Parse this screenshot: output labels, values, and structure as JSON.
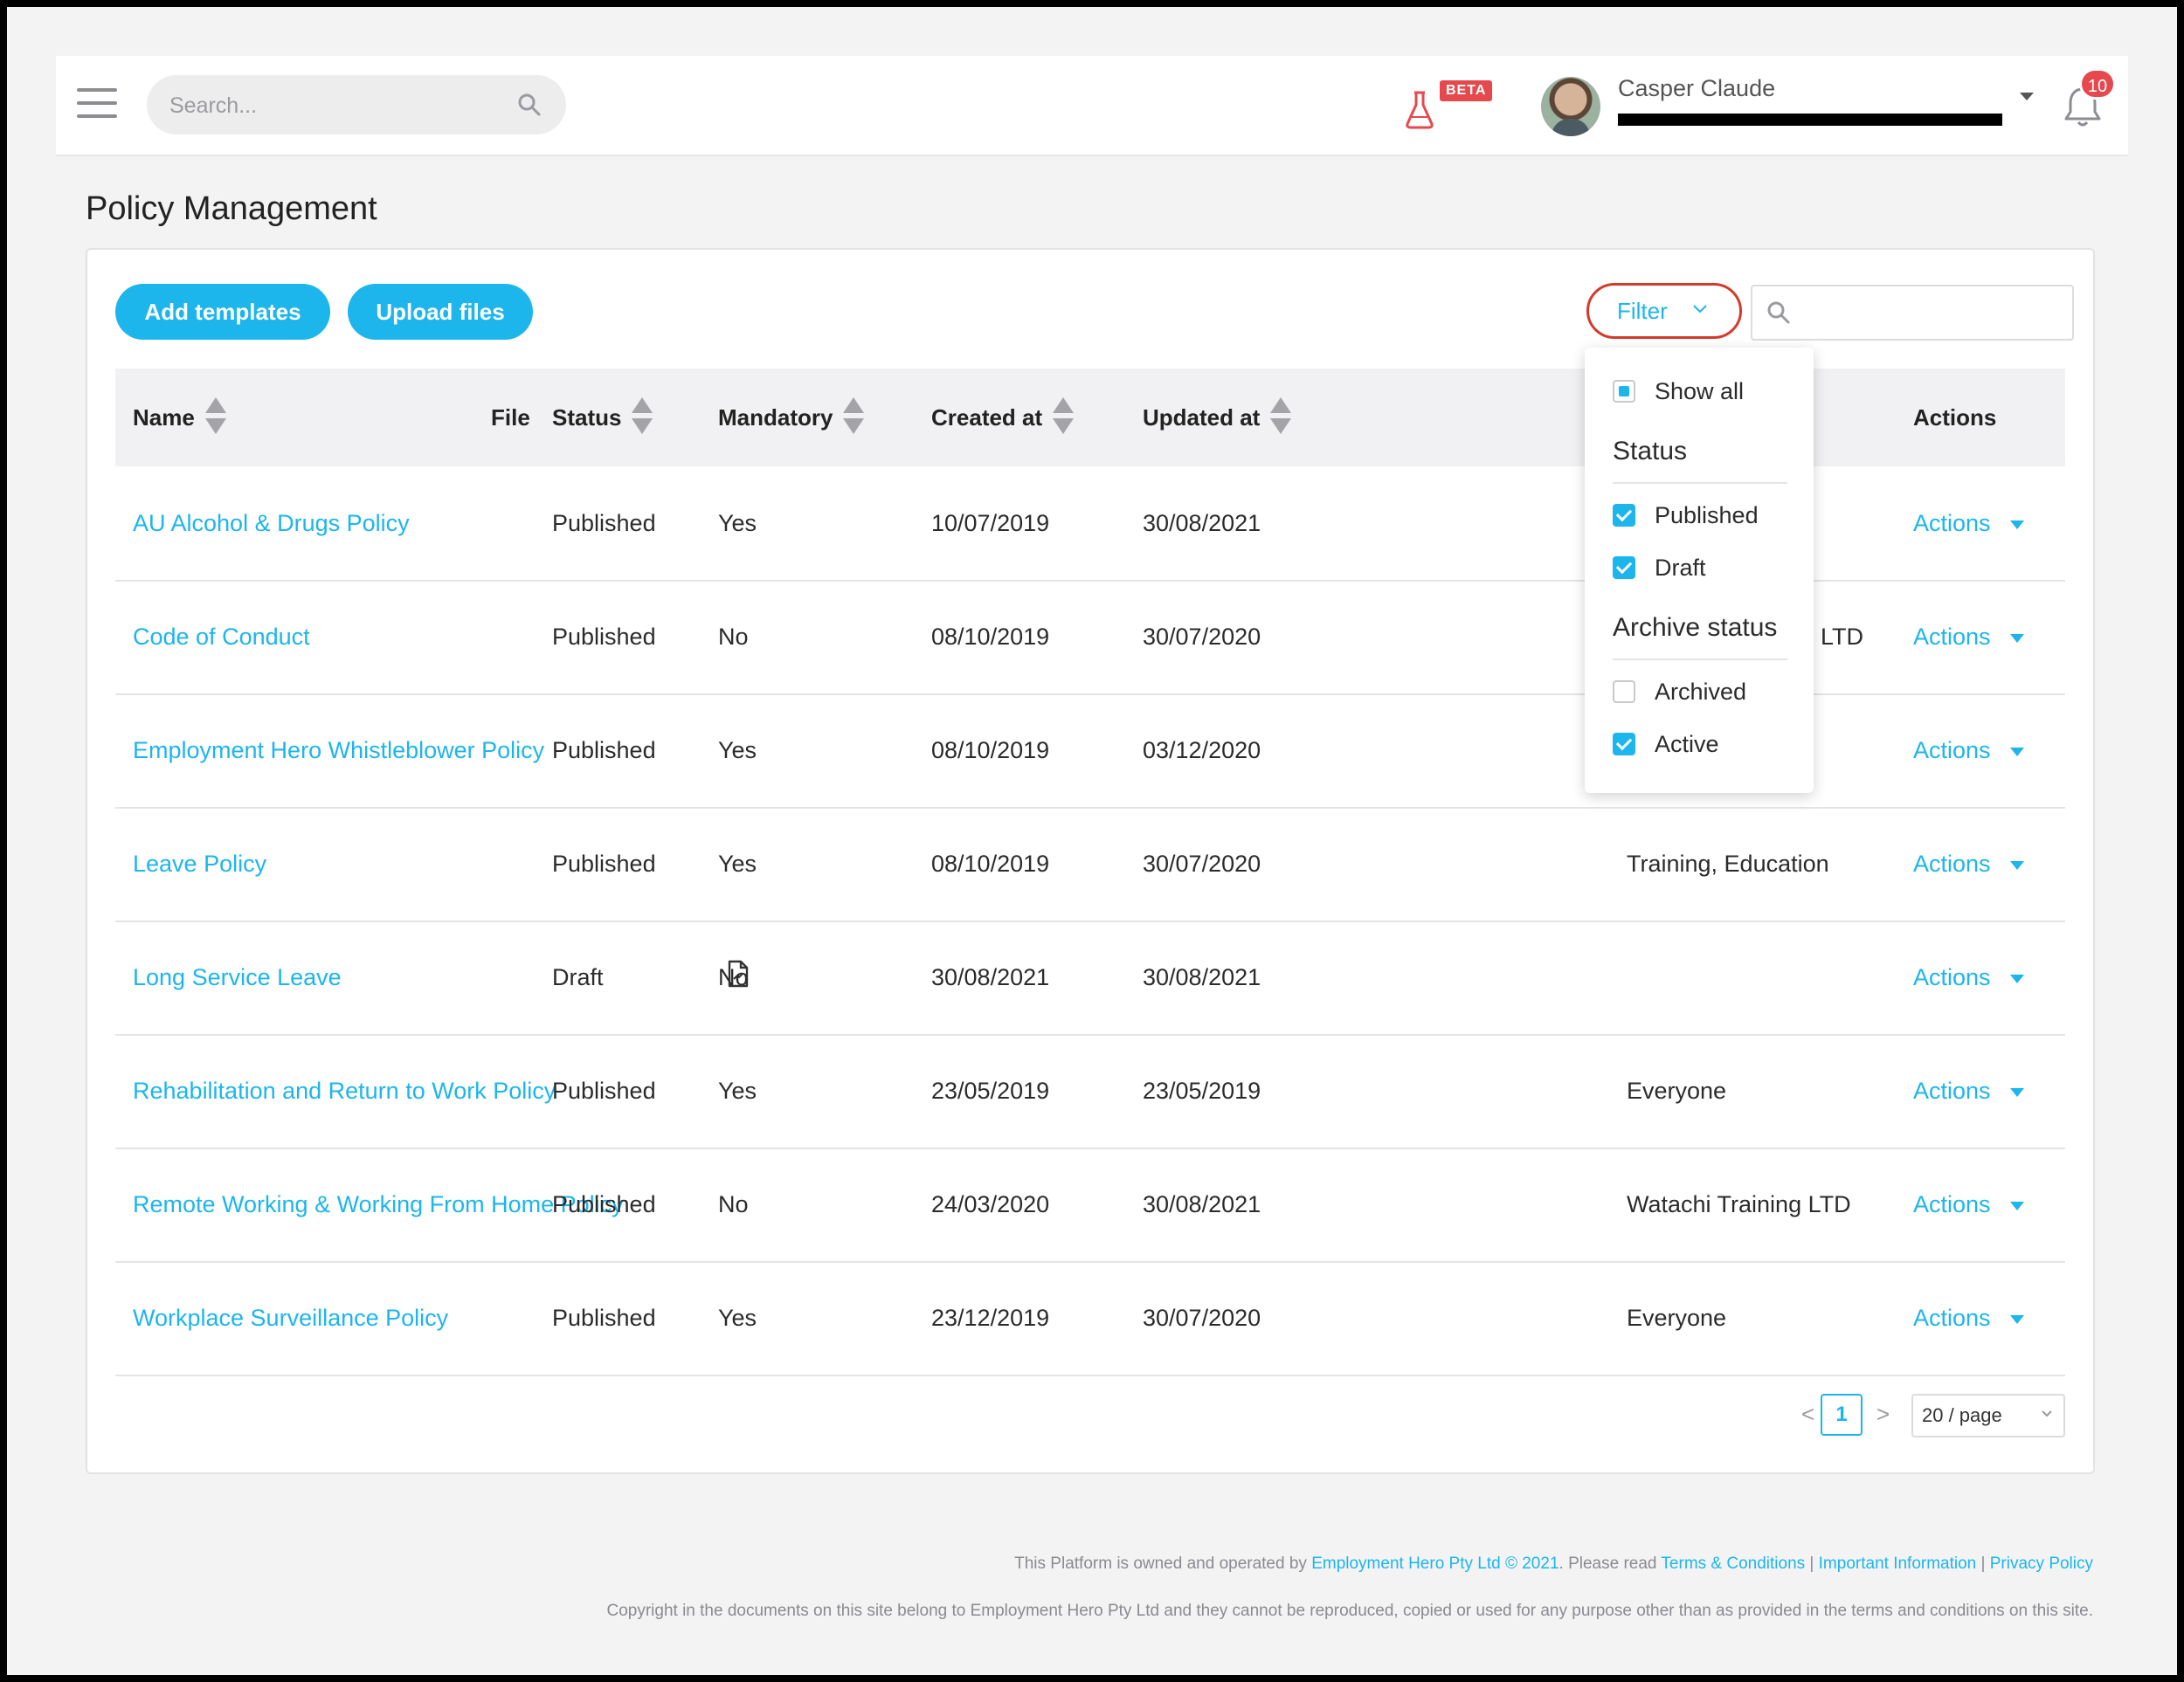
{
  "header": {
    "search_placeholder": "Search...",
    "beta_label": "BETA",
    "user_name": "Casper Claude",
    "user_email": "",
    "notification_count": "10"
  },
  "page": {
    "title": "Policy Management"
  },
  "toolbar": {
    "add_templates": "Add templates",
    "upload_files": "Upload files",
    "filter_label": "Filter",
    "search_placeholder": ""
  },
  "table": {
    "headers": {
      "name": "Name",
      "file": "File",
      "status": "Status",
      "mandatory": "Mandatory",
      "created_at": "Created at",
      "updated_at": "Updated at",
      "actions": "Actions"
    },
    "rows": [
      {
        "name": "AU Alcohol & Drugs Policy",
        "file": false,
        "status": "Published",
        "mandatory": "Yes",
        "created": "10/07/2019",
        "updated": "30/08/2021",
        "assigned": "",
        "actions": "Actions"
      },
      {
        "name": "Code of Conduct",
        "file": false,
        "status": "Published",
        "mandatory": "No",
        "created": "08/10/2019",
        "updated": "30/07/2020",
        "assigned": "LTD",
        "actions": "Actions"
      },
      {
        "name": "Employment Hero Whistleblower Policy",
        "file": false,
        "status": "Published",
        "mandatory": "Yes",
        "created": "08/10/2019",
        "updated": "03/12/2020",
        "assigned": "",
        "actions": "Actions"
      },
      {
        "name": "Leave Policy",
        "file": false,
        "status": "Published",
        "mandatory": "Yes",
        "created": "08/10/2019",
        "updated": "30/07/2020",
        "assigned": "Training, Education",
        "actions": "Actions"
      },
      {
        "name": "Long Service Leave",
        "file": true,
        "status": "Draft",
        "mandatory": "No",
        "created": "30/08/2021",
        "updated": "30/08/2021",
        "assigned": "",
        "actions": "Actions"
      },
      {
        "name": "Rehabilitation and Return to Work Policy",
        "file": false,
        "status": "Published",
        "mandatory": "Yes",
        "created": "23/05/2019",
        "updated": "23/05/2019",
        "assigned": "Everyone",
        "actions": "Actions"
      },
      {
        "name": "Remote Working & Working From Home Policy",
        "file": false,
        "status": "Published",
        "mandatory": "No",
        "created": "24/03/2020",
        "updated": "30/08/2021",
        "assigned": "Watachi Training LTD",
        "actions": "Actions"
      },
      {
        "name": "Workplace Surveillance Policy",
        "file": false,
        "status": "Published",
        "mandatory": "Yes",
        "created": "23/12/2019",
        "updated": "30/07/2020",
        "assigned": "Everyone",
        "actions": "Actions"
      }
    ]
  },
  "filter_dropdown": {
    "show_all": {
      "label": "Show all",
      "state": "partial"
    },
    "status_title": "Status",
    "status_options": [
      {
        "label": "Published",
        "checked": true
      },
      {
        "label": "Draft",
        "checked": true
      }
    ],
    "archive_title": "Archive status",
    "archive_options": [
      {
        "label": "Archived",
        "checked": false
      },
      {
        "label": "Active",
        "checked": true
      }
    ]
  },
  "pagination": {
    "prev": "<",
    "current": "1",
    "next": ">",
    "page_size": "20 / page"
  },
  "footer": {
    "line1_prefix": "This Platform is owned and operated by ",
    "line1_company": "Employment Hero Pty Ltd © 2021",
    "line1_mid": ". Please read ",
    "terms": "Terms & Conditions",
    "sep": " | ",
    "important": "Important Information",
    "privacy": "Privacy Policy",
    "line2": "Copyright in the documents on this site belong to Employment Hero Pty Ltd and they cannot be reproduced, copied or used for any purpose other than as provided in the terms and conditions on this site."
  },
  "colors": {
    "accent": "#1cb5ec",
    "danger": "#e5484d",
    "highlight_ring": "#d33a2c"
  }
}
